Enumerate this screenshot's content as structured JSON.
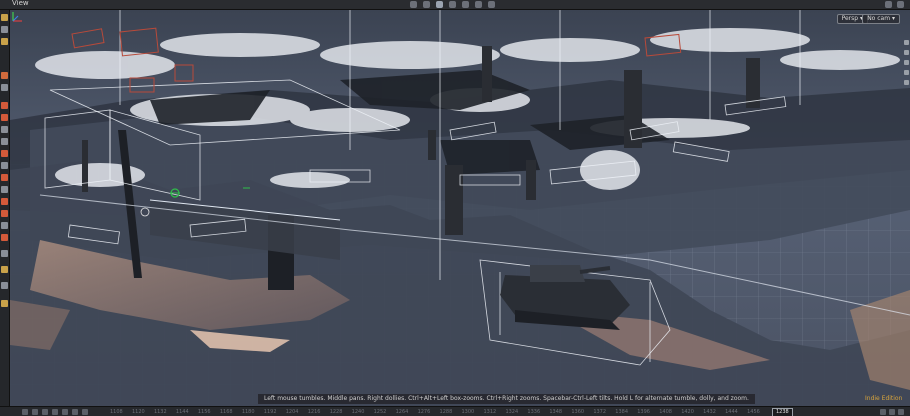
{
  "window": {
    "title": "View"
  },
  "viewport": {
    "perspective_label": "Persp ▾",
    "camera_label": "No cam ▾",
    "status_message": "Left mouse tumbles. Middle pans. Right dollies. Ctrl+Alt+Left box-zooms. Ctrl+Right zooms. Spacebar-Ctrl-Left tilts. Hold L for alternate tumble, dolly, and zoom.",
    "edition_label": "Indie Edition"
  },
  "timeline": {
    "ticks": [
      "1108",
      "1120",
      "1132",
      "1144",
      "1156",
      "1168",
      "1180",
      "1192",
      "1204",
      "1216",
      "1228",
      "1240",
      "1252",
      "1264",
      "1276",
      "1288",
      "1300",
      "1312",
      "1324",
      "1336",
      "1348",
      "1360",
      "1372",
      "1384",
      "1396",
      "1408",
      "1420",
      "1432",
      "1444",
      "1456"
    ],
    "current_frame": "1238"
  },
  "colors": {
    "grid": "#c8d4e6",
    "ground": "#4d5566",
    "selection": "#b84a3a",
    "edition": "#d7a43c",
    "accent": "#2fbf4a"
  }
}
